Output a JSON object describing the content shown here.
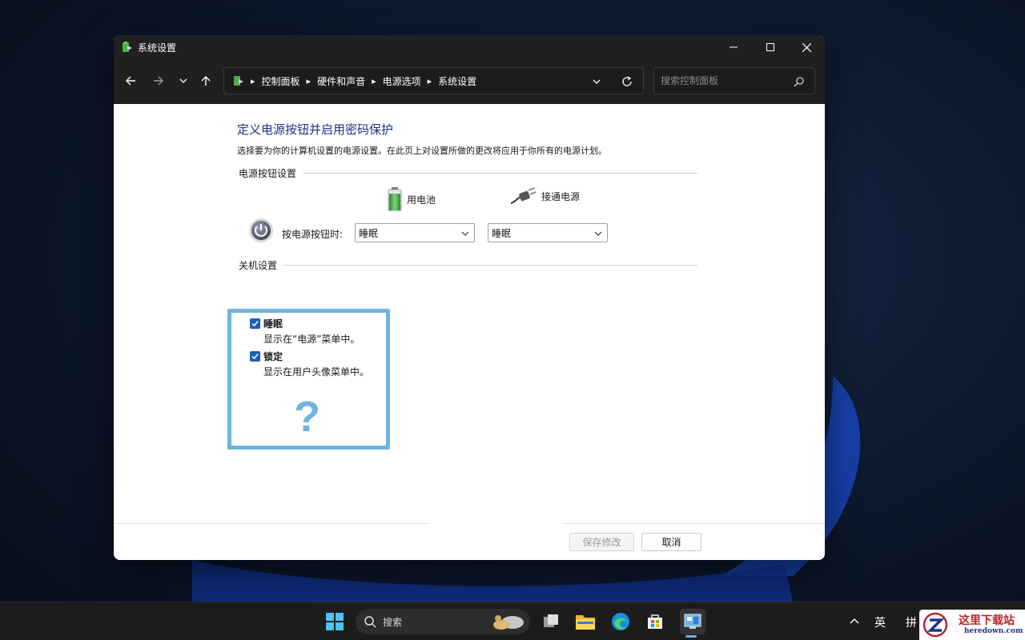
{
  "window": {
    "title": "系统设置",
    "controls": {
      "minimize": "minimize",
      "maximize": "maximize",
      "close": "close"
    }
  },
  "nav": {
    "breadcrumb": [
      "控制面板",
      "硬件和声音",
      "电源选项",
      "系统设置"
    ],
    "search_placeholder": "搜索控制面板"
  },
  "page": {
    "title": "定义电源按钮并启用密码保护",
    "description": "选择要为你的计算机设置的电源设置。在此页上对设置所做的更改将应用于你所有的电源计划。"
  },
  "power_buttons": {
    "header": "电源按钮设置",
    "col_battery": "用电池",
    "col_plugged": "接通电源",
    "row_label": "按电源按钮时:",
    "battery_value": "睡眠",
    "plugged_value": "睡眠"
  },
  "shutdown": {
    "header": "关机设置",
    "items": [
      {
        "label": "睡眠",
        "sub": "显示在“电源”菜单中。",
        "checked": true
      },
      {
        "label": "锁定",
        "sub": "显示在用户头像菜单中。",
        "checked": true
      }
    ],
    "annotation": "?"
  },
  "footer": {
    "save_label": "保存修改",
    "save_enabled": false,
    "cancel_label": "取消"
  },
  "taskbar": {
    "search_label": "搜索",
    "tray_lang": "英",
    "tray_ime": "拼"
  },
  "watermark": {
    "cn": "这里下载站",
    "en": "heredown.com"
  },
  "colors": {
    "title_blue": "#1e3287",
    "highlight": "#6fb4e0",
    "checkbox": "#1f5fb3"
  }
}
